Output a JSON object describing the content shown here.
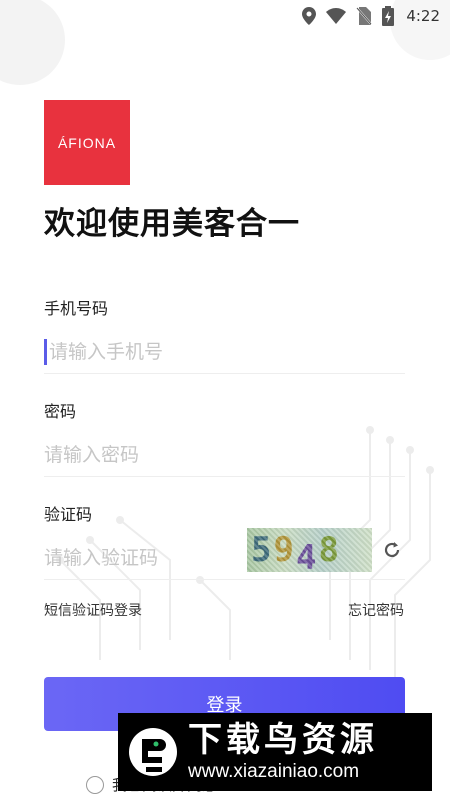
{
  "status_bar": {
    "time": "4:22",
    "icons": [
      "location-icon",
      "wifi-icon",
      "no-sim-icon",
      "battery-charging-icon"
    ]
  },
  "logo": {
    "text": "ÁFIONA",
    "color": "#e8323e"
  },
  "welcome": "欢迎使用美客合一",
  "phone": {
    "label": "手机号码",
    "placeholder": "请输入手机号",
    "value": ""
  },
  "password": {
    "label": "密码",
    "placeholder": "请输入密码",
    "value": ""
  },
  "captcha": {
    "label": "验证码",
    "placeholder": "请输入验证码",
    "value": "",
    "image_text": "5948",
    "refresh_icon": "refresh-icon"
  },
  "links": {
    "sms_login": "短信验证码登录",
    "forgot_password": "忘记密码"
  },
  "login_button": {
    "label": "登录",
    "color": "#5b59f3"
  },
  "agreement": {
    "text": "我已阅读并同意",
    "checked": false
  },
  "watermark": {
    "title": "下载鸟资源",
    "url": "www.xiazainiao.com"
  }
}
